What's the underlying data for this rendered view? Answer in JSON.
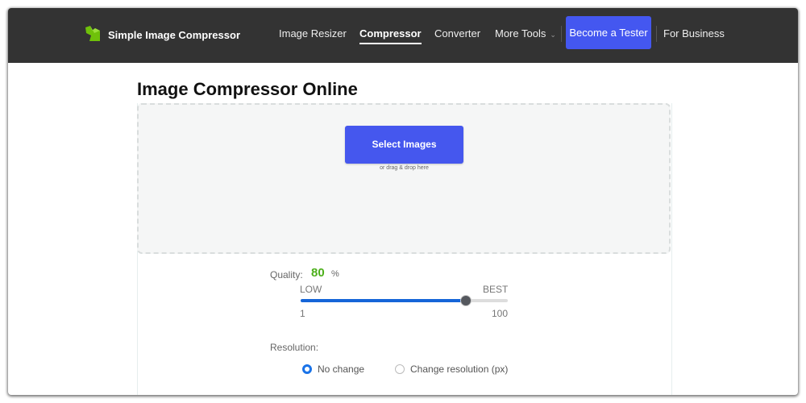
{
  "header": {
    "brand": "Simple Image Compressor",
    "nav": [
      {
        "label": "Image Resizer",
        "active": false
      },
      {
        "label": "Compressor",
        "active": true
      },
      {
        "label": "Converter",
        "active": false
      },
      {
        "label": "More Tools",
        "active": false,
        "dropdown": true
      }
    ],
    "cta_label": "Become a Tester",
    "business_label": "For Business",
    "colors": {
      "bar": "#333333",
      "cta": "#4457f0",
      "logo": "#7ac70c"
    }
  },
  "main": {
    "title": "Image Compressor Online",
    "select_button": "Select Images",
    "drag_hint": "or drag & drop here",
    "quality": {
      "label": "Quality:",
      "value": 80,
      "unit": "%",
      "low_label": "LOW",
      "best_label": "BEST",
      "min": 1,
      "max": 100
    },
    "resolution": {
      "label": "Resolution:",
      "options": [
        {
          "label": "No change",
          "checked": true
        },
        {
          "label": "Change resolution (px)",
          "checked": false
        }
      ]
    }
  }
}
